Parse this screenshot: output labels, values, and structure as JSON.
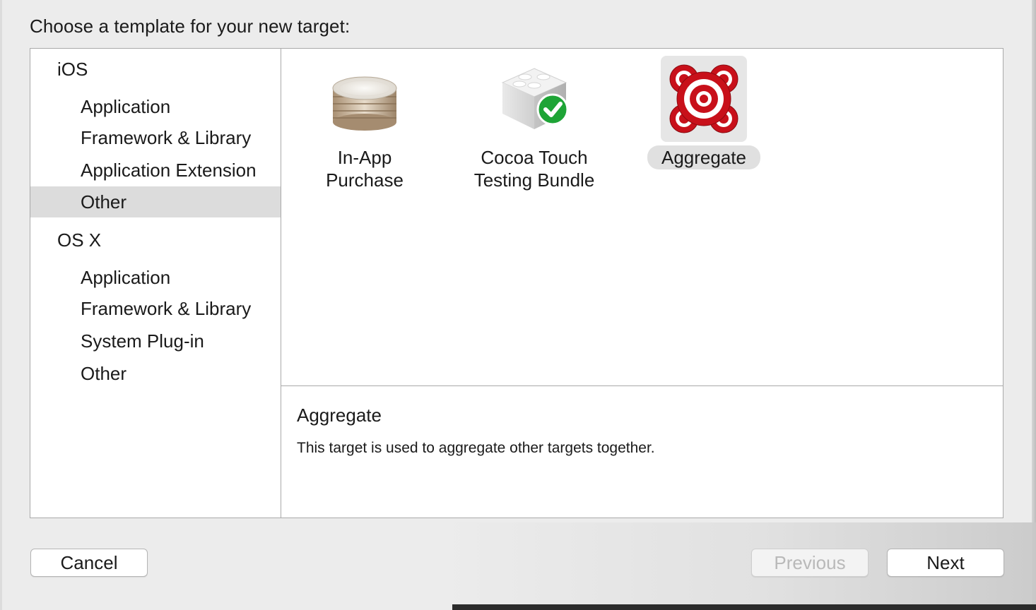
{
  "dialog": {
    "title": "Choose a template for your new target:"
  },
  "sidebar": {
    "groups": [
      {
        "label": "iOS",
        "items": [
          "Application",
          "Framework & Library",
          "Application Extension",
          "Other"
        ]
      },
      {
        "label": "OS X",
        "items": [
          "Application",
          "Framework & Library",
          "System Plug-in",
          "Other"
        ]
      }
    ],
    "selected": {
      "group": "iOS",
      "item": "Other"
    }
  },
  "templates": [
    {
      "label_line1": "In-App",
      "label_line2": "Purchase",
      "icon": "coins-icon",
      "selected": false
    },
    {
      "label_line1": "Cocoa Touch",
      "label_line2": "Testing Bundle",
      "icon": "test-bundle-icon",
      "selected": false
    },
    {
      "label_line1": "Aggregate",
      "label_line2": "",
      "icon": "target-icon",
      "selected": true
    }
  ],
  "description": {
    "title": "Aggregate",
    "text": "This target is used to aggregate other targets together."
  },
  "buttons": {
    "cancel": "Cancel",
    "previous": "Previous",
    "next": "Next"
  },
  "colors": {
    "selection_bg": "#dcdcdc",
    "target_red": "#c8101a",
    "check_green": "#1ea436"
  }
}
